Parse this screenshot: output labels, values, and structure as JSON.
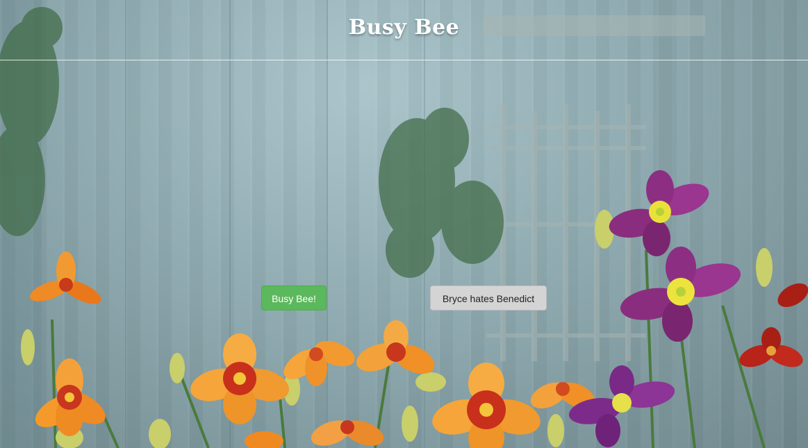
{
  "header": {
    "title": "Busy Bee"
  },
  "actions": {
    "primary_label": "Busy Bee!",
    "secondary_label": "Bryce hates Benedict"
  },
  "colors": {
    "primary_button": "#5cb85c",
    "secondary_button": "#d4d4d4",
    "title_text": "#ffffff",
    "fence": "#8eaab0"
  },
  "background": {
    "subject": "garden fence with daylilies",
    "icons": [
      "orange-daylily-icon",
      "purple-daylily-icon",
      "red-daylily-icon",
      "trellis-icon",
      "vine-icon"
    ]
  }
}
